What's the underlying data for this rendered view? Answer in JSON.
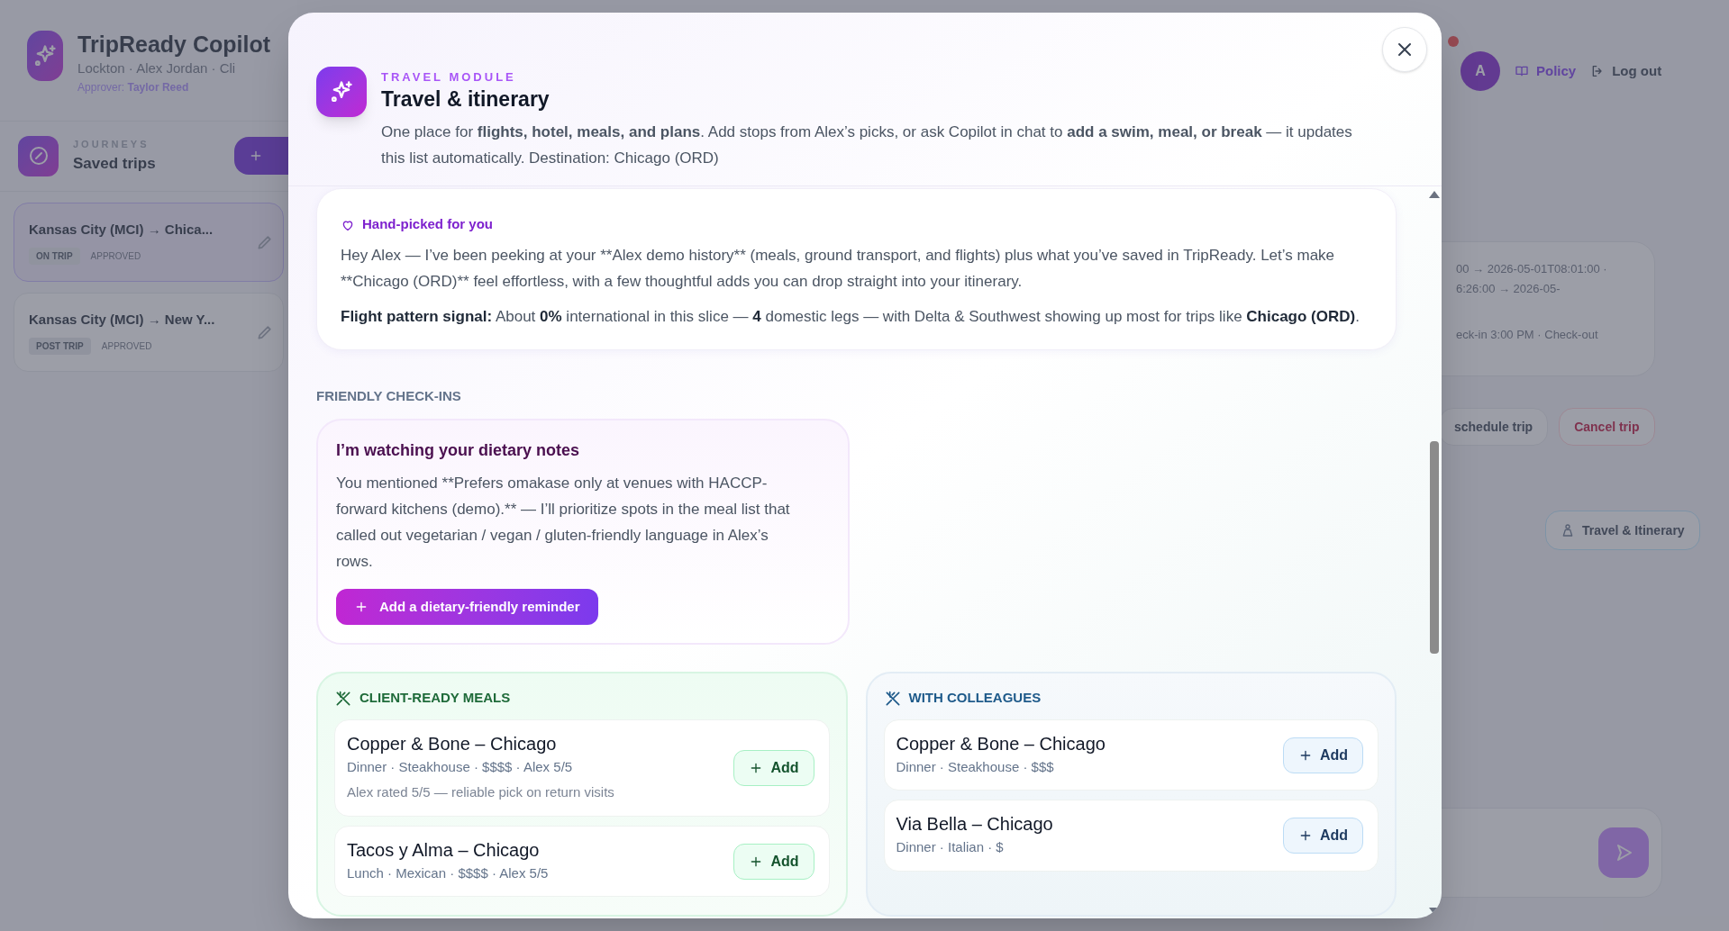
{
  "background": {
    "app_title": "TripReady Copilot",
    "account_line": "Lockton · Alex Jordan · Cli",
    "approver": "Approver: **Taylor Reed**",
    "journeys_label": "JOURNEYS",
    "journeys_title": "Saved trips",
    "trips": [
      {
        "route": "Kansas City (MCI) → Chica...",
        "status": "ON TRIP",
        "approval": "APPROVED",
        "selected": true
      },
      {
        "route": "Kansas City (MCI) → New Y...",
        "status": "POST TRIP",
        "approval": "APPROVED",
        "selected": false
      }
    ],
    "avatar": "A",
    "top_links": [
      {
        "kind": "policy",
        "label": "Policy"
      },
      {
        "kind": "logout",
        "label": "Log out"
      }
    ],
    "details_lines": [
      "00 → 2026-05-01T08:01:00 ·",
      "6:26:00 → 2026-05-",
      "eck-in 3:00 PM · Check-out"
    ],
    "actions": [
      {
        "kind": "neutral",
        "label": "schedule trip"
      },
      {
        "kind": "danger",
        "label": "Cancel trip"
      }
    ],
    "travel_button": "Travel & Itinerary"
  },
  "modal": {
    "eyebrow": "TRAVEL MODULE",
    "title": "Travel & itinerary",
    "description": "One place for **flights, hotel, meals, and plans**. Add stops from Alex’s picks, or ask Copilot in chat to **add a swim, meal, or break** — it updates this list automatically. Destination: Chicago (ORD)",
    "hand_picked": {
      "title": "Hand-picked for you",
      "intro": "Hey Alex — I’ve been peeking at your **Alex demo history** (meals, ground transport, and flights) plus what you’ve saved in TripReady. Let’s make **Chicago (ORD)** feel effortless, with a few thoughtful adds you can drop straight into your itinerary.",
      "signal": "**Flight pattern signal:** About **0%** international in this slice — **4** domestic legs — with Delta & Southwest showing up most for trips like **Chicago (ORD)**."
    },
    "checkins_heading": "FRIENDLY CHECK-INS",
    "checkin": {
      "title": "I’m watching your dietary notes",
      "body": "You mentioned **Prefers omakase only at venues with HACCP-forward kitchens (demo).** — I’ll prioritize spots in the meal list that called out vegetarian / vegan / gluten-friendly language in Alex’s rows.",
      "button": "Add a dietary-friendly reminder"
    },
    "meal_sections": [
      {
        "kind": "client",
        "title": "CLIENT-READY MEALS",
        "items": [
          {
            "name": "Copper & Bone – Chicago",
            "meta": "Dinner · Steakhouse · $$$$ · Alex 5/5",
            "note": "Alex rated 5/5 — reliable pick on return visits",
            "button": "Add"
          },
          {
            "name": "Tacos y Alma – Chicago",
            "meta": "Lunch · Mexican · $$$$ · Alex 5/5",
            "button": "Add"
          }
        ]
      },
      {
        "kind": "colleagues",
        "title": "WITH COLLEAGUES",
        "items": [
          {
            "name": "Copper & Bone – Chicago",
            "meta": "Dinner · Steakhouse · $$$",
            "button": "Add"
          },
          {
            "name": "Via Bella – Chicago",
            "meta": "Dinner · Italian · $",
            "button": "Add"
          }
        ]
      }
    ]
  }
}
